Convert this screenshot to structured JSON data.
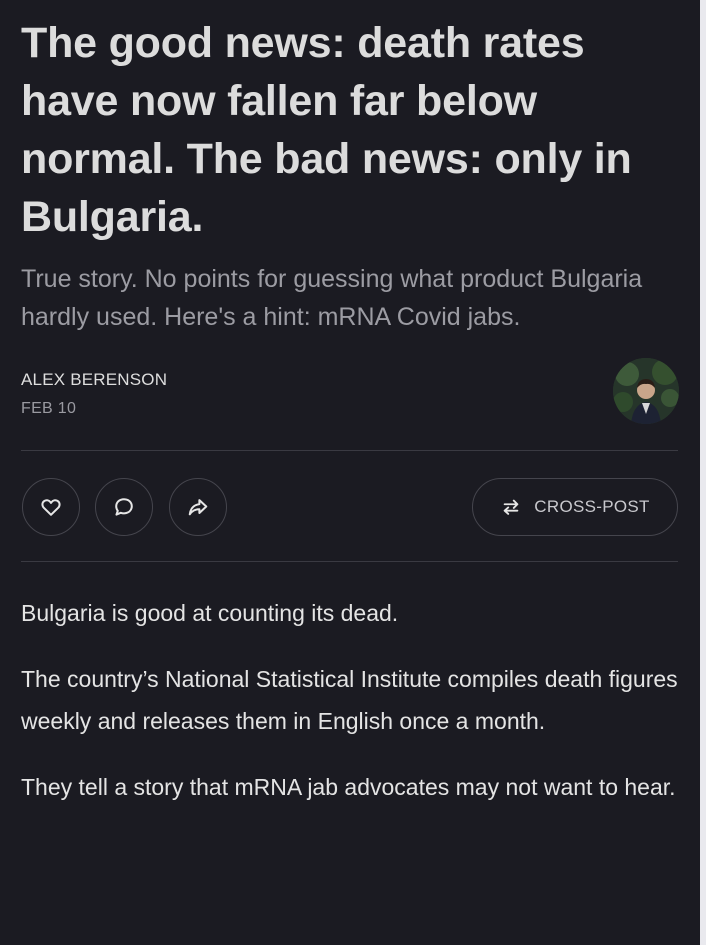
{
  "post": {
    "title": "The good news: death rates have now fallen far below normal. The bad news: only in Bulgaria.",
    "subtitle": "True story. No points for guessing what product Bulgaria hardly used. Here's a hint: mRNA Covid jabs.",
    "author": "ALEX BERENSON",
    "date": "FEB 10"
  },
  "actions": {
    "like_icon": "heart-icon",
    "comment_icon": "comment-icon",
    "share_icon": "share-icon",
    "cross_post_icon": "swap-arrows-icon",
    "cross_post_label": "CROSS-POST"
  },
  "body": {
    "paragraphs": [
      "Bulgaria is good at counting its dead.",
      "The country’s National Statistical Institute compiles death figures weekly and releases them in English once a month.",
      "They tell a story that mRNA jab advocates may not want to hear."
    ]
  },
  "colors": {
    "background": "#1b1b22",
    "title": "#dcdcdc",
    "subtitle": "#9c9ca3",
    "border": "#45454d"
  }
}
